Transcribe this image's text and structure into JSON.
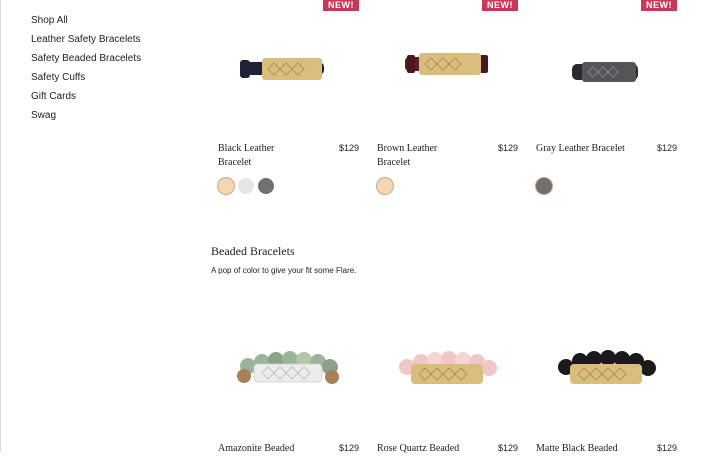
{
  "sidebar": {
    "items": [
      {
        "label": "Shop All"
      },
      {
        "label": "Leather Safety Bracelets"
      },
      {
        "label": "Safety Beaded Bracelets"
      },
      {
        "label": "Safety Cuffs"
      },
      {
        "label": "Gift Cards"
      },
      {
        "label": "Swag"
      }
    ]
  },
  "leather": {
    "products": [
      {
        "badge": "NEW!",
        "name": "Black Leather Bracelet",
        "price": "$129",
        "swatches": [
          "#f3d7b4",
          "#e5e5e5",
          "#707070"
        ]
      },
      {
        "badge": "NEW!",
        "name": "Brown Leather Bracelet",
        "price": "$129",
        "swatches": [
          "#f3d7b4"
        ]
      },
      {
        "badge": "NEW!",
        "name": "Gray Leather Bracelet",
        "price": "$129",
        "swatches": [
          "#707070"
        ]
      }
    ]
  },
  "beaded": {
    "title": "Beaded Bracelets",
    "subtitle": "A pop of color to give your fit some Flare.",
    "products": [
      {
        "name": "Amazonite Beaded",
        "price": "$129"
      },
      {
        "name": "Rose Quartz Beaded",
        "price": "$129"
      },
      {
        "name": "Matte Black Beaded",
        "price": "$129"
      }
    ]
  },
  "colors": {
    "badge": "#c6395a",
    "gold": "#d9bd7a",
    "black_leather": "#1d2236",
    "brown_leather": "#5b1f22",
    "gray_leather": "#2b2b2f",
    "amazonite": "#9bb39a",
    "rose_quartz": "#efc7c8",
    "matte_black": "#1a1a1a"
  }
}
